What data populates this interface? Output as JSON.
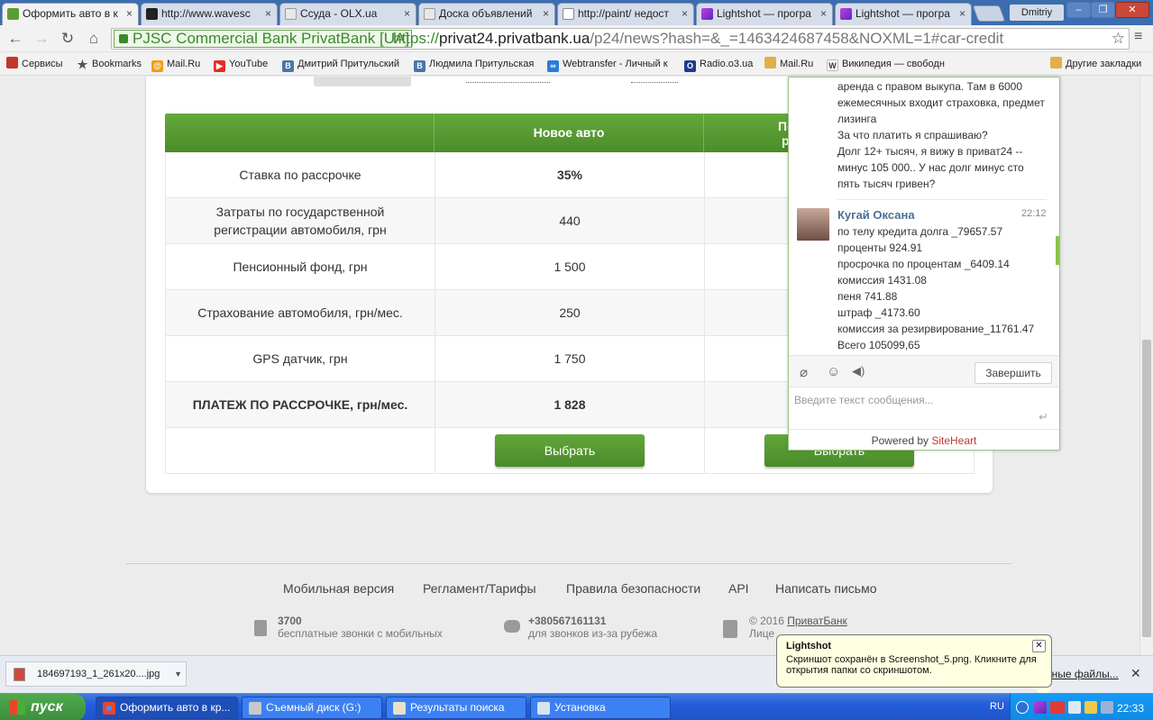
{
  "browser": {
    "tabs": [
      {
        "label": "Оформить авто в к",
        "active": true,
        "icon": "privatbank-favicon"
      },
      {
        "label": "http://www.wavesc",
        "active": false,
        "icon": "waves-favicon"
      },
      {
        "label": "Ссуда - OLX.ua",
        "active": false,
        "icon": "olx-favicon"
      },
      {
        "label": "Доска объявлений",
        "active": false,
        "icon": "olx-favicon"
      },
      {
        "label": "http://paint/ недост",
        "active": false,
        "icon": "page-icon"
      },
      {
        "label": "Lightshot — програ",
        "active": false,
        "icon": "lightshot-favicon"
      },
      {
        "label": "Lightshot — програ",
        "active": false,
        "icon": "lightshot-favicon"
      }
    ],
    "tab_close": "×",
    "user": "Dmitriy",
    "window_buttons": {
      "minimize": "–",
      "restore": "❐",
      "close": "✕"
    },
    "nav": {
      "back": "←",
      "forward": "→",
      "reload": "↻",
      "home": "⌂",
      "star": "☆",
      "menu": "≡"
    },
    "ev_certificate": "PJSC Commercial Bank PrivatBank [UA]",
    "url_scheme": "https://",
    "url_host": "privat24.privatbank.ua",
    "url_path": "/p24/news?hash=&_=1463424687458&NOXML=1#car-credit",
    "bookmarks": [
      {
        "label": "Сервисы",
        "icon": "apps-icon",
        "color": "#c0392b"
      },
      {
        "label": "Bookmarks",
        "icon": "star-icon",
        "color": "#555555"
      },
      {
        "label": "Mail.Ru",
        "icon": "mailru-icon",
        "color": "#f39c12"
      },
      {
        "label": "YouTube",
        "icon": "youtube-icon",
        "color": "#e52d27"
      },
      {
        "label": "Дмитрий Притульский",
        "icon": "vk-icon",
        "color": "#4a76a8"
      },
      {
        "label": "Людмила Притульская",
        "icon": "vk-icon",
        "color": "#4a76a8"
      },
      {
        "label": "Webtransfer - Личный к",
        "icon": "webtransfer-icon",
        "color": "#2e7bd6"
      },
      {
        "label": "Radio.o3.ua",
        "icon": "radio-icon",
        "color": "#1e3c8c"
      },
      {
        "label": "Mail.Ru",
        "icon": "folder-icon",
        "color": "#e0b04a"
      },
      {
        "label": "Википедия — свободн",
        "icon": "wikipedia-icon",
        "color": "#333333"
      }
    ],
    "other_bookmarks": "Другие закладки"
  },
  "page": {
    "table_header": {
      "col1": "",
      "col2": "Новое авто",
      "col3a": "По",
      "col3b": "р"
    },
    "rows": [
      {
        "label": "Ставка по рассрочке",
        "new_car": "35%",
        "bold": false,
        "value_bold": true
      },
      {
        "label": "Затраты по государственной регистрации автомобиля, грн",
        "new_car": "440",
        "bold": false,
        "value_bold": false
      },
      {
        "label": "Пенсионный фонд, грн",
        "new_car": "1 500",
        "bold": false,
        "value_bold": false
      },
      {
        "label": "Страхование автомобиля, грн/мес.",
        "new_car": "250",
        "bold": false,
        "value_bold": false
      },
      {
        "label": "GPS датчик, грн",
        "new_car": "1 750",
        "bold": false,
        "value_bold": false
      },
      {
        "label": "ПЛАТЕЖ ПО РАССРОЧКЕ, грн/мес.",
        "new_car": "1 828",
        "bold": true,
        "value_bold": true
      }
    ],
    "select_button": "Выбрать",
    "select_button_2": "Выбрать",
    "footer_links": [
      "Мобильная версия",
      "Регламент/Тарифы",
      "Правила безопасности",
      "API",
      "Написать письмо"
    ],
    "footer_phone1": {
      "number": "3700",
      "desc": "бесплатные звонки с мобильных"
    },
    "footer_phone2": {
      "number": "+380567161131",
      "desc": "для звонков из-за рубежа"
    },
    "footer_copyright": "© 2016",
    "footer_bank": "ПриватБанк",
    "footer_license": "Лице"
  },
  "chat": {
    "prev_message_lines": [
      "аренда с правом выкупа. Там в 6000",
      "ежемесячных входит страховка, предмет",
      "лизинга",
      "За что платить я спрашиваю?",
      "Долг 12+ тысяч, я вижу в приват24 --",
      "минус 105 000.. У нас долг минус сто",
      "пять тысяч гривен?"
    ],
    "agent_name": "Кугай Оксана",
    "time": "22:12",
    "agent_message_lines": [
      "по телу кредита долга _79657.57",
      "проценты 924.91",
      "просрочка по процентам _6409.14",
      "комиссия 1431.08",
      "пеня 741.88",
      "штраф _4173.60",
      "комиссия за резирвирование_11761.47",
      "Всего 105099,65"
    ],
    "end_button": "Завершить",
    "input_placeholder": "Введите текст сообщения...",
    "powered_by": "Powered by ",
    "powered_brand": "SiteHeart"
  },
  "downloads": {
    "file": "184697193_1_261x20....jpg",
    "all_files": "нные файлы...",
    "close": "✕"
  },
  "balloon": {
    "title": "Lightshot",
    "text": "Скриншот сохранён в Screenshot_5.png. Кликните для открытия папки со скриншотом.",
    "close": "✕"
  },
  "taskbar": {
    "start": "пуск",
    "tasks": [
      {
        "label": "Оформить авто в кр...",
        "icon": "chrome-icon",
        "active": true
      },
      {
        "label": "Съемный диск (G:)",
        "icon": "drive-icon",
        "active": false
      },
      {
        "label": "Результаты поиска",
        "icon": "search-results-icon",
        "active": false
      },
      {
        "label": "Установка",
        "icon": "installer-icon",
        "active": false
      }
    ],
    "language": "RU",
    "time": "22:33"
  },
  "colors": {
    "brand_green": "#5a9e33",
    "chrome_blue": "#3b6db0",
    "taskbar_blue": "#245edb"
  }
}
